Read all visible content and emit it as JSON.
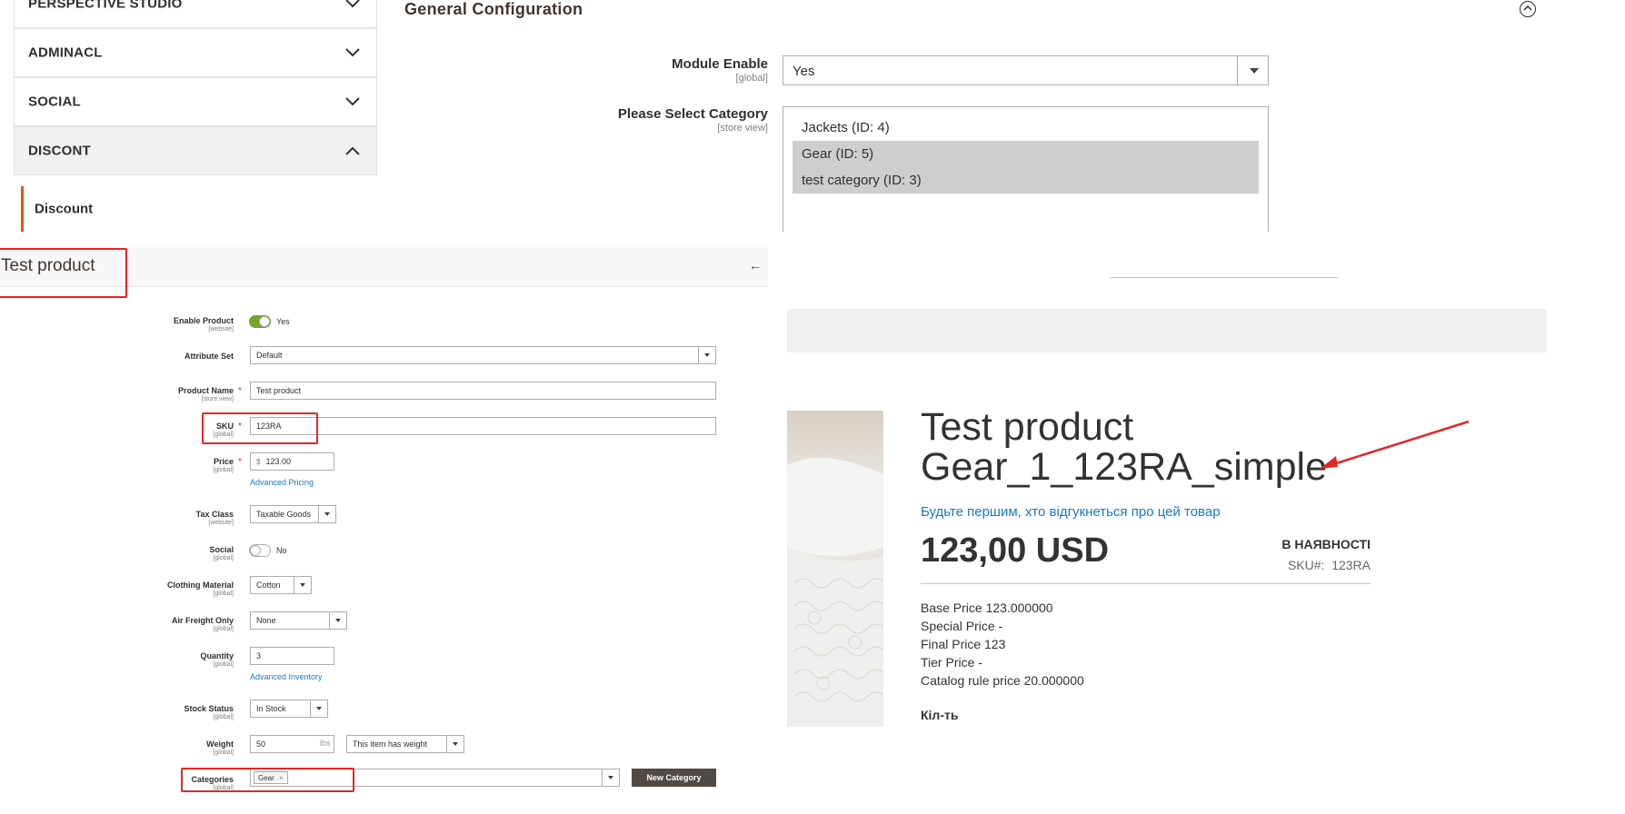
{
  "config": {
    "sections": [
      {
        "label": "PERSPECTIVE STUDIO"
      },
      {
        "label": "ADMINACL"
      },
      {
        "label": "SOCIAL"
      },
      {
        "label": "DISCONT"
      }
    ],
    "active_item": "Discount",
    "group_title": "General Configuration",
    "fields": {
      "module_enable": {
        "label": "Module Enable",
        "scope": "[global]",
        "value": "Yes"
      },
      "category": {
        "label": "Please Select Category",
        "scope": "[store view]"
      }
    },
    "category_options": [
      {
        "label": "Jackets (ID: 4)",
        "selected": false
      },
      {
        "label": "Gear (ID: 5)",
        "selected": true
      },
      {
        "label": "test category (ID: 3)",
        "selected": true
      }
    ]
  },
  "product_edit": {
    "title": "Test product",
    "back_icon": "arrow-left-icon",
    "fields": {
      "enable": {
        "label": "Enable Product",
        "scope": "[website]",
        "value": "Yes"
      },
      "attribute_set": {
        "label": "Attribute Set",
        "value": "Default"
      },
      "name": {
        "label": "Product Name",
        "scope": "[store view]",
        "value": "Test product",
        "required": "*"
      },
      "sku": {
        "label": "SKU",
        "scope": "[global]",
        "value": "123RA",
        "required": "*"
      },
      "price": {
        "label": "Price",
        "scope": "[global]",
        "currency": "$",
        "value": "123.00",
        "required": "*",
        "link": "Advanced Pricing"
      },
      "tax_class": {
        "label": "Tax Class",
        "scope": "[website]",
        "value": "Taxable Goods"
      },
      "social": {
        "label": "Social",
        "scope": "[global]",
        "value": "No"
      },
      "clothing_material": {
        "label": "Clothing Material",
        "scope": "[global]",
        "value": "Cotton"
      },
      "air_freight": {
        "label": "Air Freight Only",
        "scope": "[global]",
        "value": "None"
      },
      "quantity": {
        "label": "Quantity",
        "scope": "[global]",
        "value": "3",
        "link": "Advanced Inventory"
      },
      "stock_status": {
        "label": "Stock Status",
        "scope": "[global]",
        "value": "In Stock"
      },
      "weight": {
        "label": "Weight",
        "scope": "[global]",
        "value": "50",
        "unit": "lbs",
        "type": "This item has weight"
      },
      "categories": {
        "label": "Categories",
        "scope": "[global]",
        "tag": "Gear",
        "tag_remove": "×",
        "button": "New Category"
      }
    }
  },
  "storefront": {
    "title_line1": "Test product",
    "title_line2": "Gear_1_123RA_simple",
    "review_link": "Будьте першим, хто відгукнеться про цей товар",
    "price": "123,00 USD",
    "stock": "В НАЯВНОСТІ",
    "sku_label": "SKU#:",
    "sku_value": "123RA",
    "info_lines": [
      "Base Price 123.000000",
      "Special Price -",
      "Final Price 123",
      "Tier Price -",
      "Catalog rule price 20.000000"
    ],
    "qty_label": "Кіл-ть"
  },
  "colors": {
    "accent": "#eb5202",
    "highlight": "#e22626",
    "link": "#1979c3",
    "toggle_on": "#79a22e"
  }
}
